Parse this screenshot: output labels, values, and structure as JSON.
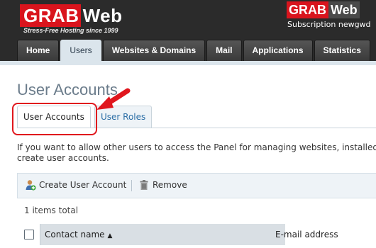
{
  "header": {
    "logo_part1": "GRAB",
    "logo_part2": "Web",
    "tagline": "Stress-Free Hosting since 1999",
    "plan_logo_part1": "GRAB",
    "plan_logo_part2": "Web",
    "subscription_text": "Subscription  newgwd"
  },
  "nav": {
    "tabs": [
      {
        "label": "Home",
        "active": false
      },
      {
        "label": "Users",
        "active": true
      },
      {
        "label": "Websites & Domains",
        "active": false
      },
      {
        "label": "Mail",
        "active": false
      },
      {
        "label": "Applications",
        "active": false
      },
      {
        "label": "Statistics",
        "active": false
      }
    ]
  },
  "page": {
    "title": "User Accounts",
    "subtabs": [
      {
        "label": "User Accounts",
        "active": true
      },
      {
        "label": "User Roles",
        "active": false
      }
    ],
    "intro_line1": "If you want to allow other users to access the Panel for managing websites, installed a",
    "intro_line2": "create user accounts."
  },
  "toolbar": {
    "create_label": "Create User Account",
    "remove_label": "Remove"
  },
  "list": {
    "items_total": "1 items total",
    "columns": [
      "Contact name",
      "E-mail address"
    ]
  },
  "colors": {
    "brand_red": "#d9141d",
    "topbar": "#2b2b2b",
    "accent_blue": "#2c6ea6"
  }
}
